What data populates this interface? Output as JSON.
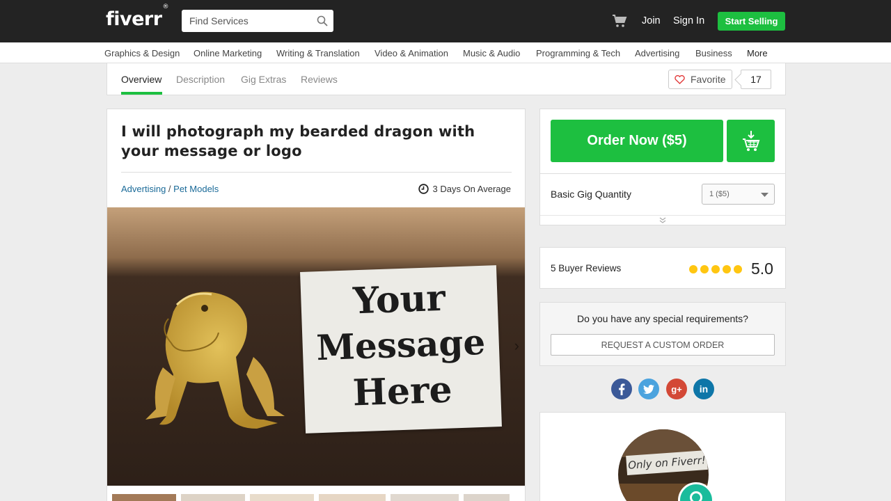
{
  "header": {
    "logo": "fiverr",
    "logo_mark": "®",
    "search_placeholder": "Find Services",
    "join": "Join",
    "sign_in": "Sign In",
    "start_selling": "Start Selling"
  },
  "categories": [
    "Graphics & Design",
    "Online Marketing",
    "Writing & Translation",
    "Video & Animation",
    "Music & Audio",
    "Programming & Tech",
    "Advertising",
    "Business",
    "More"
  ],
  "gig_tabs": [
    "Overview",
    "Description",
    "Gig Extras",
    "Reviews"
  ],
  "favorite": {
    "label": "Favorite",
    "count": "17"
  },
  "gig": {
    "title": "I will photograph my bearded dragon with your message or logo",
    "breadcrumb_category": "Advertising",
    "breadcrumb_separator": " / ",
    "breadcrumb_subcategory": "Pet Models",
    "delivery": "3 Days On Average",
    "image_sign": [
      "Your",
      "Message",
      "Here"
    ]
  },
  "order": {
    "button": "Order Now ($5)",
    "quantity_label": "Basic Gig Quantity",
    "quantity_value": "1 ($5)"
  },
  "reviews": {
    "label": "5 Buyer Reviews",
    "rating": 5,
    "rating_text": "5.0"
  },
  "custom": {
    "question": "Do you have any special requirements?",
    "button": "REQUEST A CUSTOM ORDER"
  },
  "social": [
    "facebook",
    "twitter",
    "google-plus",
    "linkedin"
  ],
  "seller_card": {
    "video_caption": "Only on Fiverr!"
  },
  "colors": {
    "brand_green": "#1dbf40",
    "header_bg": "#232323",
    "link_blue": "#1a6a98",
    "star_yellow": "#ffc611"
  }
}
